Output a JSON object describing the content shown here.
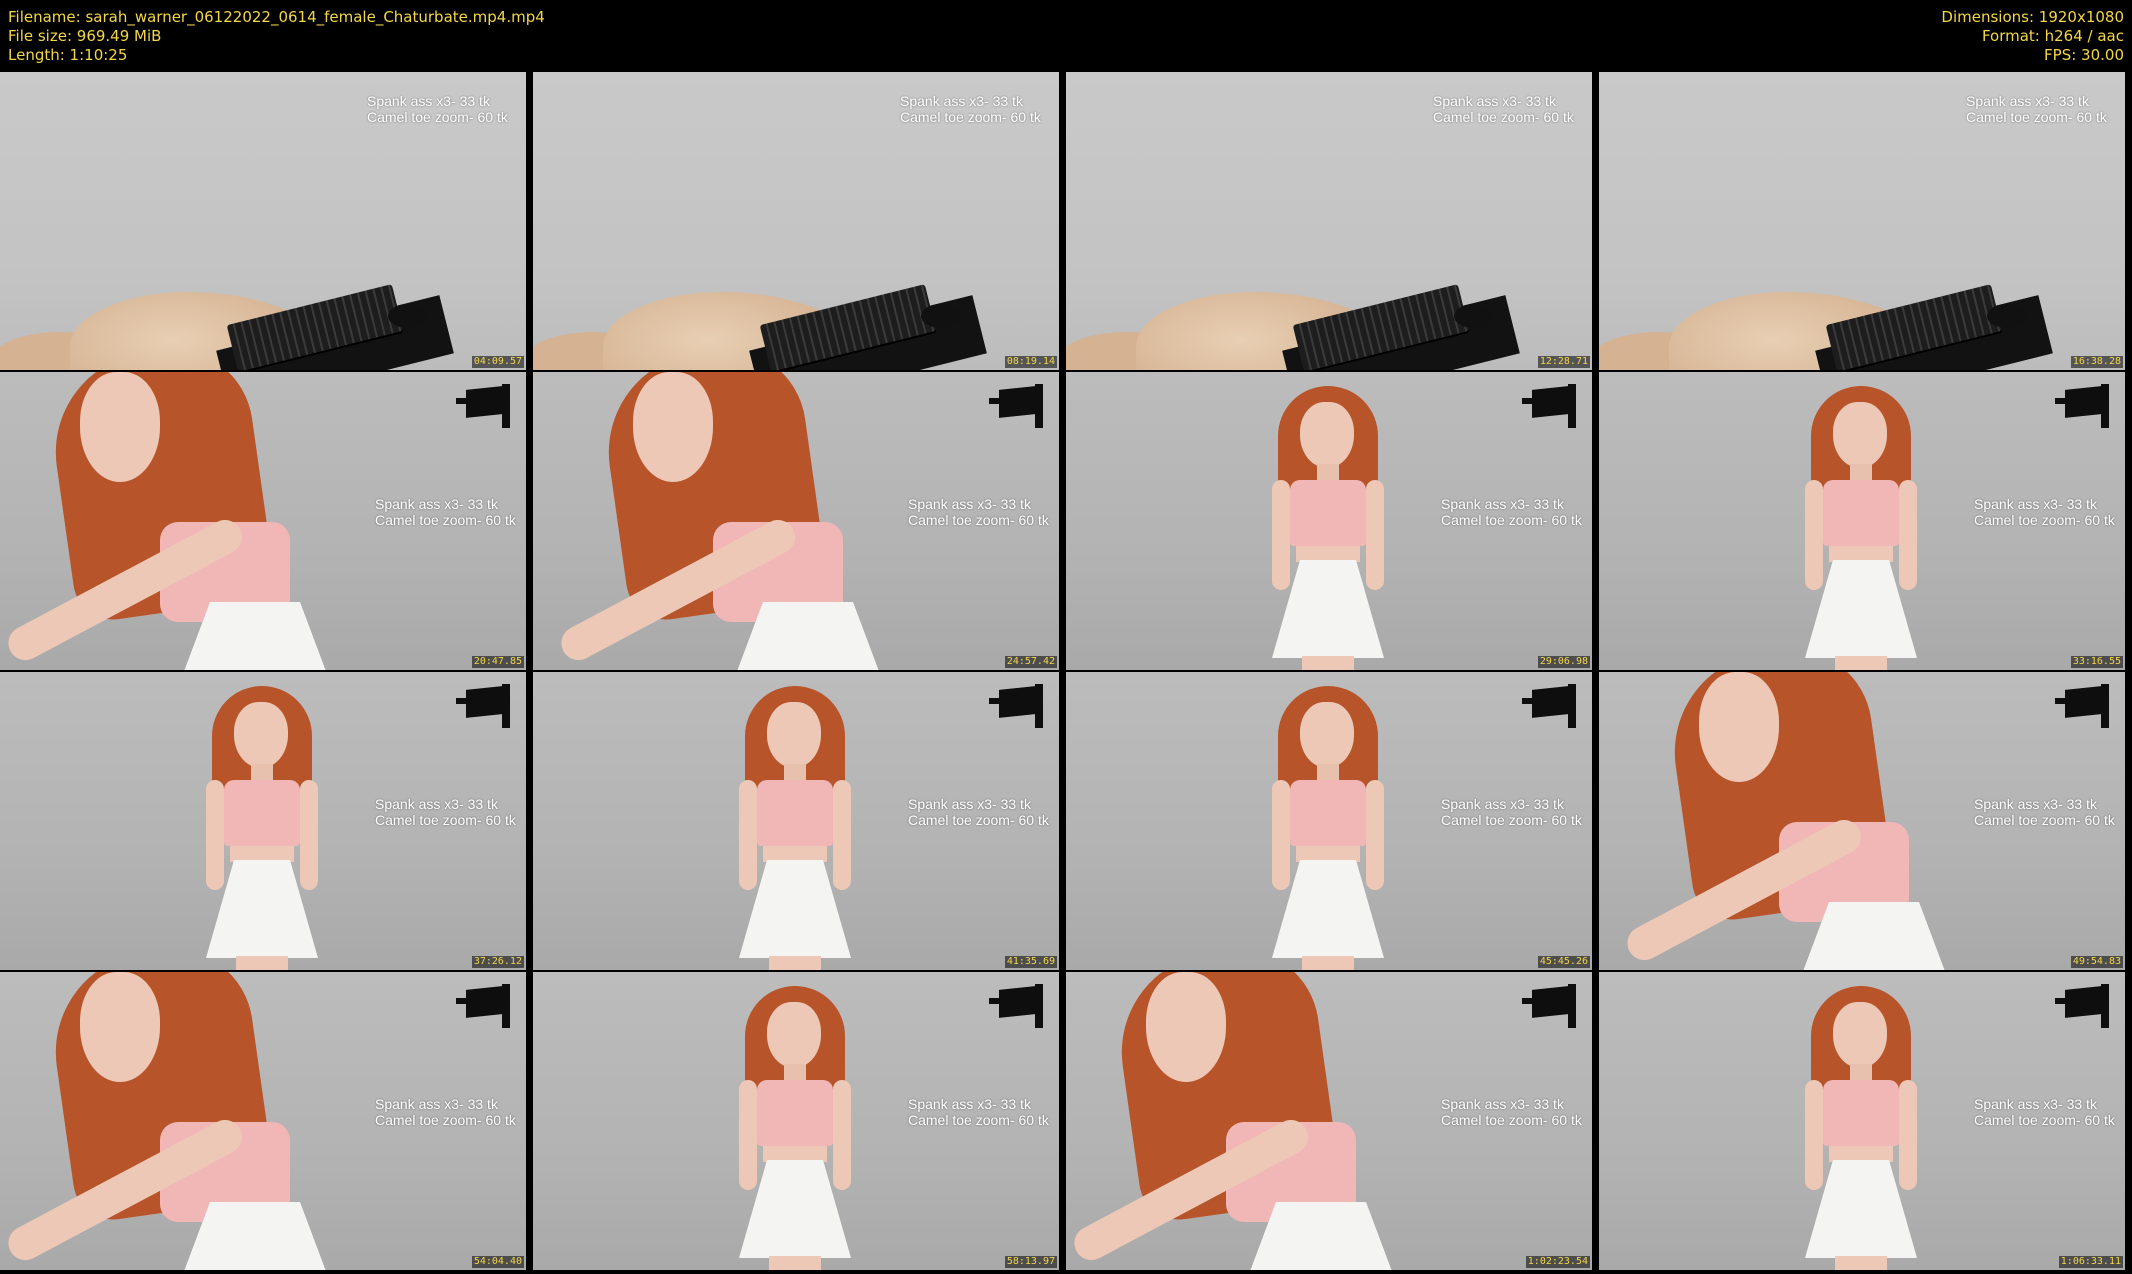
{
  "header": {
    "filename_line": "Filename: sarah_warner_06122022_0614_female_Chaturbate.mp4.mp4",
    "filesize_line": "File size: 969.49 MiB",
    "length_line": "Length: 1:10:25",
    "dimensions_line": "Dimensions: 1920x1080",
    "format_line": "Format: h264 / aac",
    "fps_line": "FPS: 30.00"
  },
  "colors": {
    "meta_text": "#f2d64b",
    "background": "#000000"
  },
  "overlay": {
    "line1": "Spank ass x3- 33 tk",
    "line2": "Camel toe zoom- 60 tk"
  },
  "thumbnails": [
    {
      "timestamp": "04:09.57",
      "scene": "room"
    },
    {
      "timestamp": "08:19.14",
      "scene": "room"
    },
    {
      "timestamp": "12:28.71",
      "scene": "room"
    },
    {
      "timestamp": "16:38.28",
      "scene": "room"
    },
    {
      "timestamp": "20:47.85",
      "scene": "lean"
    },
    {
      "timestamp": "24:57.42",
      "scene": "lean"
    },
    {
      "timestamp": "29:06.98",
      "scene": "standing"
    },
    {
      "timestamp": "33:16.55",
      "scene": "standing"
    },
    {
      "timestamp": "37:26.12",
      "scene": "standing"
    },
    {
      "timestamp": "41:35.69",
      "scene": "standing"
    },
    {
      "timestamp": "45:45.26",
      "scene": "standing"
    },
    {
      "timestamp": "49:54.83",
      "scene": "lean"
    },
    {
      "timestamp": "54:04.40",
      "scene": "lean"
    },
    {
      "timestamp": "58:13.97",
      "scene": "standing"
    },
    {
      "timestamp": "1:02:23.54",
      "scene": "lean"
    },
    {
      "timestamp": "1:06:33.11",
      "scene": "standing"
    }
  ]
}
